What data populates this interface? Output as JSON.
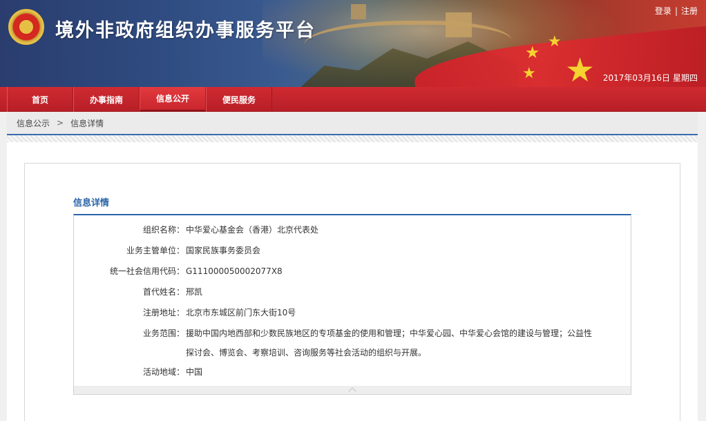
{
  "site": {
    "title": "境外非政府组织办事服务平台"
  },
  "auth": {
    "login": "登录",
    "separator": "|",
    "register": "注册"
  },
  "date": {
    "value": "2017年03月16日",
    "weekday": "星期四"
  },
  "nav": {
    "items": [
      {
        "label": "首页"
      },
      {
        "label": "办事指南"
      },
      {
        "label": "信息公开",
        "active": true
      },
      {
        "label": "便民服务"
      }
    ]
  },
  "breadcrumb": {
    "parent": "信息公示",
    "arrow": ">",
    "current": "信息详情"
  },
  "detail": {
    "title": "信息详情",
    "rows": [
      {
        "label": "组织名称：",
        "value": "中华爱心基金会（香港）北京代表处"
      },
      {
        "label": "业务主管单位：",
        "value": "国家民族事务委员会"
      },
      {
        "label": "统一社会信用代码：",
        "value": "G111000050002077X8"
      },
      {
        "label": "首代姓名：",
        "value": "邢凯"
      },
      {
        "label": "注册地址：",
        "value": "北京市东城区前门东大街10号"
      },
      {
        "label": "业务范围：",
        "value": "援助中国内地西部和少数民族地区的专项基金的使用和管理；中华爱心园、中华爱心会馆的建设与管理；公益性探讨会、博览会、考察培训、咨询服务等社会活动的组织与开展。"
      },
      {
        "label": "活动地域：",
        "value": "中国"
      }
    ]
  },
  "icons": {
    "emblem": "national-emblem-icon",
    "collapse": "chevron-up-icon"
  },
  "colors": {
    "nav_red": "#c3232b",
    "accent_blue": "#2b64a8",
    "star_yellow": "#f5d230"
  }
}
